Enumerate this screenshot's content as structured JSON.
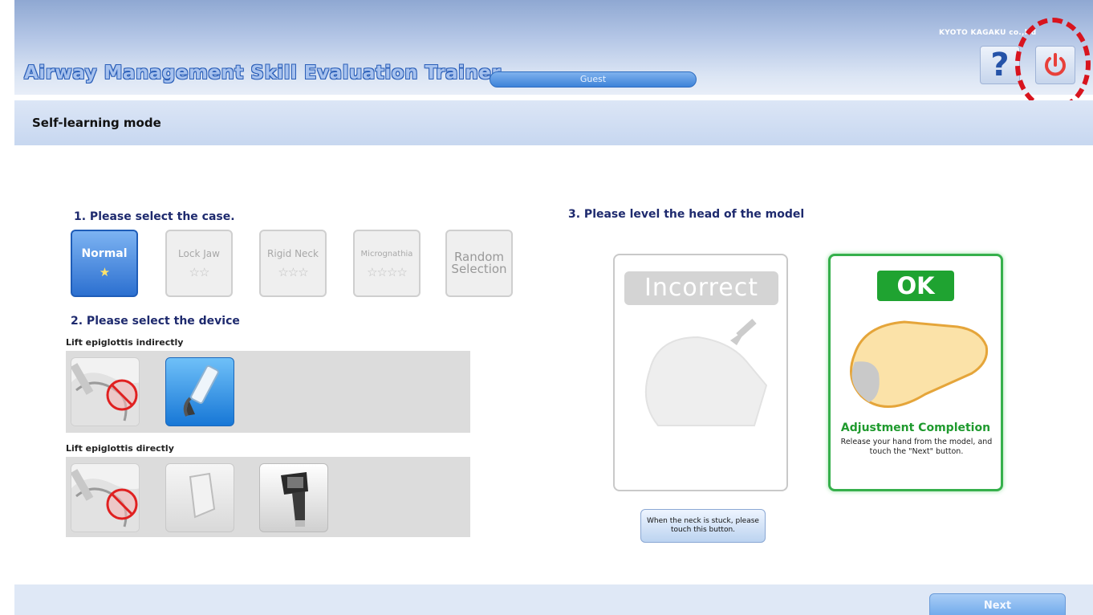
{
  "header": {
    "app_title": "Airway Management Skill Evaluation Trainer",
    "user": "Guest",
    "company": "KYOTO KAGAKU co.,ltd",
    "help_icon": "question-mark-icon",
    "power_icon": "power-icon",
    "highlight_color": "#d8141e"
  },
  "mode": {
    "title": "Self-learning mode"
  },
  "case_section": {
    "title": "1. Please select the case.",
    "cases": [
      {
        "label": "Normal",
        "stars": "★",
        "selected": true
      },
      {
        "label": "Lock Jaw",
        "stars": "☆☆"
      },
      {
        "label": "Rigid Neck",
        "stars": "☆☆☆"
      },
      {
        "label": "Micrognathia",
        "stars": "☆☆☆☆"
      },
      {
        "label": "Random Selection",
        "stars": ""
      }
    ]
  },
  "device_section": {
    "title": "2. Please select the device",
    "indirect_label": "Lift epiglottis indirectly",
    "direct_label": "Lift epiglottis directly"
  },
  "level_section": {
    "title": "3. Please level the head of the model",
    "incorrect_label": "Incorrect",
    "ok_label": "OK",
    "completion_title": "Adjustment Completion",
    "completion_text": "Release your hand from the model, and touch the \"Next\" button.",
    "stuck_button": "When the neck is stuck, please touch this button."
  },
  "footer": {
    "next_label": "Next"
  }
}
